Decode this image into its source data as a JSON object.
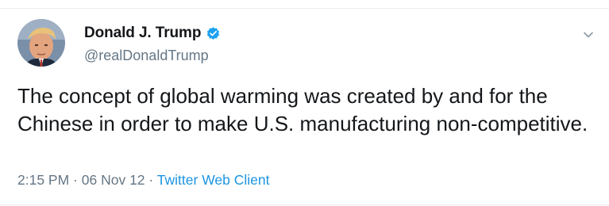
{
  "tweet": {
    "author": {
      "display_name": "Donald J. Trump",
      "handle": "@realDonaldTrump",
      "verified": true,
      "avatar_icon": "profile-photo"
    },
    "text": "The concept of global warming was created by and for the Chinese in order to make U.S. manufacturing non-competitive.",
    "time": "2:15 PM",
    "separator": "·",
    "date": "06 Nov 12",
    "source": "Twitter Web Client",
    "menu_icon": "chevron-down-icon"
  },
  "colors": {
    "text": "#14171a",
    "secondary": "#657786",
    "link": "#1b95e0",
    "verified_badge": "#1da1f2",
    "divider": "#e6ecf0"
  }
}
